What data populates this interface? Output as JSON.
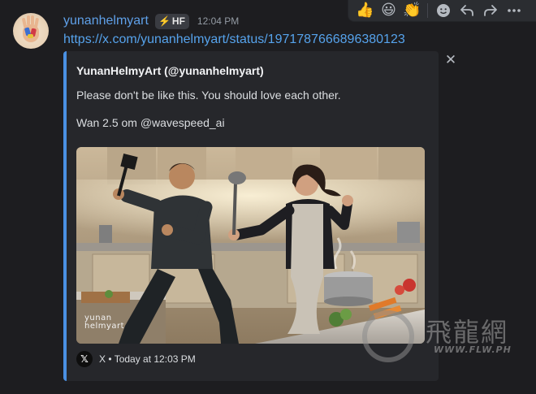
{
  "message": {
    "username": "yunanhelmyart",
    "role_badge": {
      "icon": "lightning-bolt-icon",
      "label": "HF"
    },
    "timestamp": "12:04 PM",
    "link": "https://x.com/yunanhelmyart/status/1971787666896380123"
  },
  "toolbar": {
    "reactions": [
      {
        "name": "thumbs-up-emoji",
        "glyph": "👍"
      },
      {
        "name": "grinning-face-emoji",
        "glyph": "😃"
      },
      {
        "name": "clapping-hands-emoji",
        "glyph": "👏"
      }
    ],
    "icons": [
      "add-reaction-icon",
      "reply-icon",
      "forward-icon",
      "more-options-icon"
    ]
  },
  "embed": {
    "accent_color": "#4a90e2",
    "author": "YunanHelmyArt (@yunanhelmyart)",
    "description": [
      "Please don't be like this. You should love each other.",
      "Wan 2.5 om @wavespeed_ai"
    ],
    "image_watermark_line1": "yunan",
    "image_watermark_line2": "helmyart",
    "footer": {
      "provider": "X",
      "separator": "•",
      "time": "Today at 12:03 PM"
    }
  },
  "site_watermark": {
    "chinese": "飛龍網",
    "url": "WWW.FLW.PH"
  }
}
